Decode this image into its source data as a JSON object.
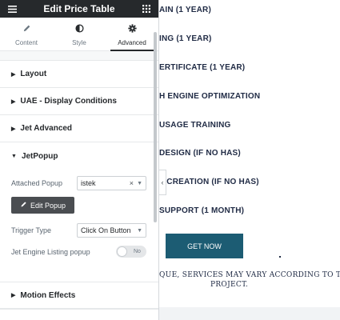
{
  "panel": {
    "title": "Edit Price Table",
    "menu_icon": "hamburger-icon",
    "grid_icon": "grid-icon",
    "tabs": [
      {
        "label": "Content",
        "icon": "pencil-icon"
      },
      {
        "label": "Style",
        "icon": "half-circle-icon"
      },
      {
        "label": "Advanced",
        "icon": "gear-icon",
        "active": true
      }
    ],
    "sections": {
      "layout": "Layout",
      "uae": "UAE - Display Conditions",
      "jet_advanced": "Jet Advanced",
      "jetpopup": "JetPopup",
      "motion": "Motion Effects"
    },
    "jetpopup": {
      "attached_label": "Attached Popup",
      "attached_value": "istek",
      "edit_button": "Edit Popup",
      "trigger_label": "Trigger Type",
      "trigger_value": "Click On Button",
      "listing_label": "Jet Engine Listing popup",
      "toggle_label": "No"
    }
  },
  "preview": {
    "features": [
      "AIN (1 YEAR)",
      "ING (1 YEAR)",
      "ERTIFICATE (1 YEAR)",
      "H ENGINE OPTIMIZATION",
      "USAGE TRAINING",
      "DESIGN (IF NO HAS)",
      "T CREATION (IF NO HAS)",
      "SUPPORT (1 MONTH)"
    ],
    "button": "GET NOW",
    "note_line1": "QUE, SERVICES MAY VARY ACCORDING TO THE",
    "note_line2": "PROJECT."
  },
  "colors": {
    "header_bg": "#26292c",
    "button_bg": "#1c5c73",
    "text_dark": "#1f2a44"
  }
}
